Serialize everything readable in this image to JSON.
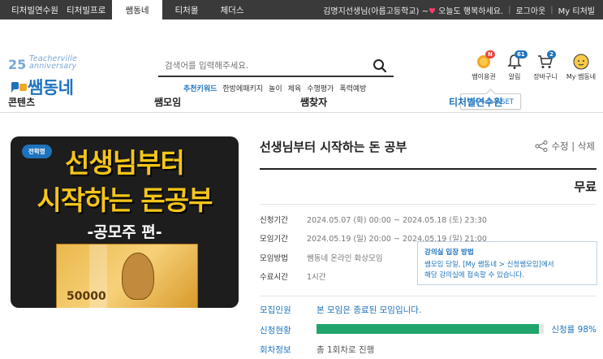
{
  "topbar": {
    "tabs": [
      "티처빌연수원",
      "티처빌프로",
      "쌤동네",
      "티처몰",
      "체더스"
    ],
    "user_greeting_pre": "김명지선생님(아름고등학교) ~",
    "user_greeting_post": " 오늘도 행복하세요.",
    "logout": "로그아웃",
    "my_teacherville": "My 티처빌"
  },
  "logo": {
    "sub_line1": "Teacherville",
    "sub_line2": "anniversary",
    "main": "쌤동네"
  },
  "search": {
    "placeholder": "검색어를 입력해주세요.",
    "keywords_title": "추천키워드",
    "keywords": [
      "한방에패키지",
      "놀이",
      "체육",
      "수행평가",
      "폭력예방"
    ]
  },
  "user_icons": [
    {
      "label": "쌤이용권",
      "badge": "N"
    },
    {
      "label": "알림",
      "badge": "61"
    },
    {
      "label": "장바구니",
      "badge": "2"
    },
    {
      "label": "My 쌤동네",
      "badge": ""
    }
  ],
  "tooltip": "연수+교구 SET",
  "gnb": [
    "콘텐츠",
    "쌤모임",
    "쌤찾자",
    "티처빌연수원"
  ],
  "poster": {
    "tag": "전학령",
    "line1": "선생님부터",
    "line2": "시작하는 돈공부",
    "line3": "-공모주 편-",
    "bill_value": "50000"
  },
  "detail": {
    "title": "선생님부터 시작하는 돈 공부",
    "edit": "수정",
    "delete": "삭제",
    "price": "무료",
    "rows": [
      {
        "label": "신청기간",
        "value": "2024.05.07 (화) 00:00 ~ 2024.05.18 (토) 23:30"
      },
      {
        "label": "모임기간",
        "value": "2024.05.19 (일) 20:00 ~ 2024.05.19 (일) 21:00"
      },
      {
        "label": "모임방법",
        "value": "쌤동네 온라인 화상모임"
      },
      {
        "label": "수료시간",
        "value": "1시간"
      }
    ],
    "notice_title": "강의실 입장 방법",
    "notice_line1": "쌤모임 당일, [My 쌤동네 > 신청쌤모임]에서",
    "notice_line2": "해당 강의실에 접속할 수 있습니다.",
    "recruit_label": "모집인원",
    "recruit_value": "본 모임은 종료된 모임입니다.",
    "status_label": "신청현황",
    "status_rate_text": "신청률 98%",
    "status_rate": 98,
    "session_label": "회차정보",
    "session_value": "총 1회차로 진행"
  },
  "colors": {
    "accent": "#1e73be",
    "progress": "#20a46b",
    "topbar": "#3a3a3a"
  }
}
